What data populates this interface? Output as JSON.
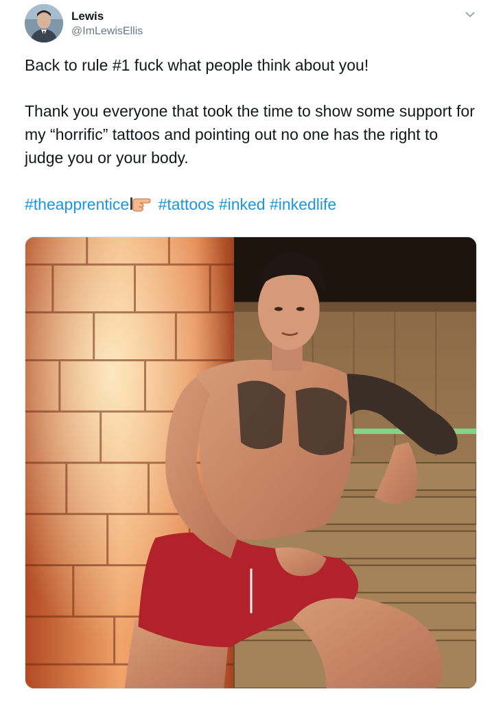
{
  "author": {
    "name": "Lewis",
    "handle": "@ImLewisEllis"
  },
  "tweet": {
    "line1": "Back to rule #1 fuck what people think about you!",
    "paragraph2": "Thank you everyone that took the time to show some support for my “horrific” tattoos and pointing out no one has the right to judge you or your body.",
    "hashtags": [
      "#theapprentice",
      "#tattoos",
      "#inked",
      "#inkedlife"
    ],
    "emoji": "pointing-finger-emoji"
  },
  "colors": {
    "link": "#1b95e0",
    "text": "#14171a",
    "secondary": "#657786"
  },
  "media": {
    "description_icon": "photo"
  }
}
